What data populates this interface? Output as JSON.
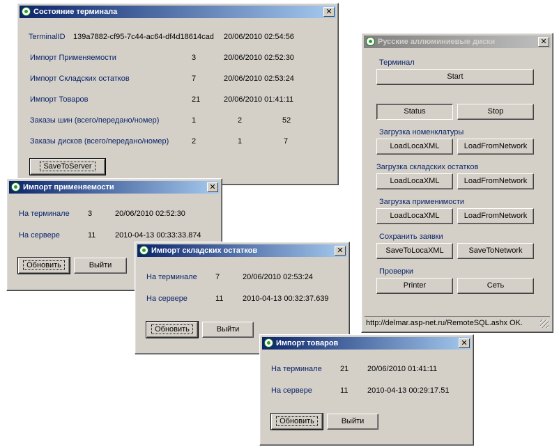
{
  "terminal_state": {
    "title": "Состояние терминала",
    "close": "✕",
    "terminal_id_label": "TerminalID",
    "terminal_id_value": "139a7882-cf95-7c44-ac64-df4d18614cad",
    "terminal_id_time": "20/06/2010 02:54:56",
    "rows": [
      {
        "label": "Импорт Применяемости",
        "count": "3",
        "time": "20/06/2010 02:52:30"
      },
      {
        "label": "Импорт Складских остатков",
        "count": "7",
        "time": "20/06/2010 02:53:24"
      },
      {
        "label": "Импорт Товаров",
        "count": "21",
        "time": "20/06/2010 01:41:11"
      }
    ],
    "orders_tires": {
      "label": "Заказы шин (всего/передано/номер)",
      "a": "1",
      "b": "2",
      "c": "52"
    },
    "orders_disks": {
      "label": "Заказы дисков (всего/передано/номер)",
      "a": "2",
      "b": "1",
      "c": "7"
    },
    "save_button": "SaveToServer"
  },
  "import_applicability": {
    "title": "Импорт применяемости",
    "close": "✕",
    "on_terminal_label": "На терминале",
    "on_terminal_count": "3",
    "on_terminal_time": "20/06/2010 02:52:30",
    "on_server_label": "На сервере",
    "on_server_count": "11",
    "on_server_time": "2010-04-13 00:33:33.874",
    "refresh_button": "Обновить",
    "exit_button": "Выйти"
  },
  "import_stock": {
    "title": "Импорт складских остатков",
    "close": "✕",
    "on_terminal_label": "На терминале",
    "on_terminal_count": "7",
    "on_terminal_time": "20/06/2010 02:53:24",
    "on_server_label": "На сервере",
    "on_server_count": "11",
    "on_server_time": "2010-04-13 00:32:37.639",
    "refresh_button": "Обновить",
    "exit_button": "Выйти"
  },
  "import_goods": {
    "title": "Импорт товаров",
    "close": "✕",
    "on_terminal_label": "На терминале",
    "on_terminal_count": "21",
    "on_terminal_time": "20/06/2010 01:41:11",
    "on_server_label": "На сервере",
    "on_server_count": "11",
    "on_server_time": "2010-04-13 00:29:17.51",
    "refresh_button": "Обновить",
    "exit_button": "Выйти"
  },
  "main_window": {
    "title": "Русские аллюминиевые диски",
    "close": "✕",
    "terminal_label": "Терминал",
    "start_button": "Start",
    "status_button": "Status",
    "stop_button": "Stop",
    "nomenclature_label": "Загрузка номенклатуры",
    "stock_label": "Загрузка складских остатков",
    "applicability_label": "Загрузка применимости",
    "load_local": "LoadLocaXML",
    "load_network": "LoadFromNetwork",
    "save_orders_label": "Сохранить заявки",
    "save_local": "SaveToLocaXML",
    "save_network": "SaveToNetwork",
    "checks_label": "Проверки",
    "printer_button": "Printer",
    "network_button": "Сеть",
    "status_text": "http://delmar.asp-net.ru/RemoteSQL.ashx OK."
  }
}
